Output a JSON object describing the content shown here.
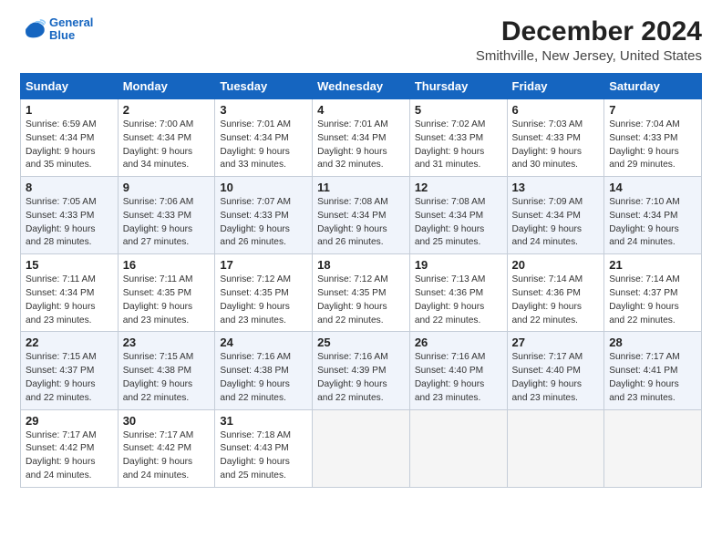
{
  "logo": {
    "line1": "General",
    "line2": "Blue"
  },
  "title": "December 2024",
  "subtitle": "Smithville, New Jersey, United States",
  "headers": [
    "Sunday",
    "Monday",
    "Tuesday",
    "Wednesday",
    "Thursday",
    "Friday",
    "Saturday"
  ],
  "weeks": [
    [
      {
        "day": "1",
        "sunrise": "6:59 AM",
        "sunset": "4:34 PM",
        "daylight": "9 hours and 35 minutes."
      },
      {
        "day": "2",
        "sunrise": "7:00 AM",
        "sunset": "4:34 PM",
        "daylight": "9 hours and 34 minutes."
      },
      {
        "day": "3",
        "sunrise": "7:01 AM",
        "sunset": "4:34 PM",
        "daylight": "9 hours and 33 minutes."
      },
      {
        "day": "4",
        "sunrise": "7:01 AM",
        "sunset": "4:34 PM",
        "daylight": "9 hours and 32 minutes."
      },
      {
        "day": "5",
        "sunrise": "7:02 AM",
        "sunset": "4:33 PM",
        "daylight": "9 hours and 31 minutes."
      },
      {
        "day": "6",
        "sunrise": "7:03 AM",
        "sunset": "4:33 PM",
        "daylight": "9 hours and 30 minutes."
      },
      {
        "day": "7",
        "sunrise": "7:04 AM",
        "sunset": "4:33 PM",
        "daylight": "9 hours and 29 minutes."
      }
    ],
    [
      {
        "day": "8",
        "sunrise": "7:05 AM",
        "sunset": "4:33 PM",
        "daylight": "9 hours and 28 minutes."
      },
      {
        "day": "9",
        "sunrise": "7:06 AM",
        "sunset": "4:33 PM",
        "daylight": "9 hours and 27 minutes."
      },
      {
        "day": "10",
        "sunrise": "7:07 AM",
        "sunset": "4:33 PM",
        "daylight": "9 hours and 26 minutes."
      },
      {
        "day": "11",
        "sunrise": "7:08 AM",
        "sunset": "4:34 PM",
        "daylight": "9 hours and 26 minutes."
      },
      {
        "day": "12",
        "sunrise": "7:08 AM",
        "sunset": "4:34 PM",
        "daylight": "9 hours and 25 minutes."
      },
      {
        "day": "13",
        "sunrise": "7:09 AM",
        "sunset": "4:34 PM",
        "daylight": "9 hours and 24 minutes."
      },
      {
        "day": "14",
        "sunrise": "7:10 AM",
        "sunset": "4:34 PM",
        "daylight": "9 hours and 24 minutes."
      }
    ],
    [
      {
        "day": "15",
        "sunrise": "7:11 AM",
        "sunset": "4:34 PM",
        "daylight": "9 hours and 23 minutes."
      },
      {
        "day": "16",
        "sunrise": "7:11 AM",
        "sunset": "4:35 PM",
        "daylight": "9 hours and 23 minutes."
      },
      {
        "day": "17",
        "sunrise": "7:12 AM",
        "sunset": "4:35 PM",
        "daylight": "9 hours and 23 minutes."
      },
      {
        "day": "18",
        "sunrise": "7:12 AM",
        "sunset": "4:35 PM",
        "daylight": "9 hours and 22 minutes."
      },
      {
        "day": "19",
        "sunrise": "7:13 AM",
        "sunset": "4:36 PM",
        "daylight": "9 hours and 22 minutes."
      },
      {
        "day": "20",
        "sunrise": "7:14 AM",
        "sunset": "4:36 PM",
        "daylight": "9 hours and 22 minutes."
      },
      {
        "day": "21",
        "sunrise": "7:14 AM",
        "sunset": "4:37 PM",
        "daylight": "9 hours and 22 minutes."
      }
    ],
    [
      {
        "day": "22",
        "sunrise": "7:15 AM",
        "sunset": "4:37 PM",
        "daylight": "9 hours and 22 minutes."
      },
      {
        "day": "23",
        "sunrise": "7:15 AM",
        "sunset": "4:38 PM",
        "daylight": "9 hours and 22 minutes."
      },
      {
        "day": "24",
        "sunrise": "7:16 AM",
        "sunset": "4:38 PM",
        "daylight": "9 hours and 22 minutes."
      },
      {
        "day": "25",
        "sunrise": "7:16 AM",
        "sunset": "4:39 PM",
        "daylight": "9 hours and 22 minutes."
      },
      {
        "day": "26",
        "sunrise": "7:16 AM",
        "sunset": "4:40 PM",
        "daylight": "9 hours and 23 minutes."
      },
      {
        "day": "27",
        "sunrise": "7:17 AM",
        "sunset": "4:40 PM",
        "daylight": "9 hours and 23 minutes."
      },
      {
        "day": "28",
        "sunrise": "7:17 AM",
        "sunset": "4:41 PM",
        "daylight": "9 hours and 23 minutes."
      }
    ],
    [
      {
        "day": "29",
        "sunrise": "7:17 AM",
        "sunset": "4:42 PM",
        "daylight": "9 hours and 24 minutes."
      },
      {
        "day": "30",
        "sunrise": "7:17 AM",
        "sunset": "4:42 PM",
        "daylight": "9 hours and 24 minutes."
      },
      {
        "day": "31",
        "sunrise": "7:18 AM",
        "sunset": "4:43 PM",
        "daylight": "9 hours and 25 minutes."
      },
      null,
      null,
      null,
      null
    ]
  ]
}
